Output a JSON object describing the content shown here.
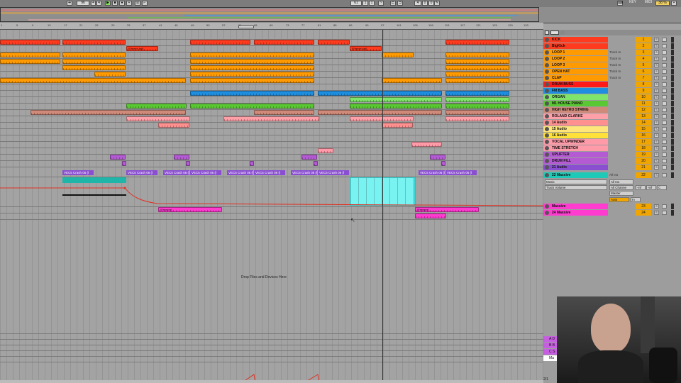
{
  "transport": {
    "tempo": "96",
    "time_sig_num": "4",
    "time_sig_den": "4",
    "bar_pos": "61",
    "beat_pos": "1",
    "sub_pos": "1",
    "loop_len": "4",
    "loop_beat": "0",
    "loop_sub": "0",
    "key_label": "KEY",
    "midi_label": "MIDI",
    "cpu": "38 %"
  },
  "ruler": {
    "ticks": [
      "1",
      "5",
      "9",
      "13",
      "17",
      "21",
      "25",
      "29",
      "33",
      "37",
      "41",
      "45",
      "49",
      "53",
      "57",
      "61",
      "65",
      "69",
      "73",
      "77",
      "81",
      "85",
      "89",
      "93",
      "97",
      "101",
      "105",
      "109",
      "113",
      "117",
      "121",
      "125",
      "129",
      "133"
    ]
  },
  "arrangement": {
    "drop_hint": "Drop Files and Devices Here",
    "freeze_tail_label": "(Freeze tail)",
    "freezer_label": "(Freezer)",
    "crash_label": "VEC5 Crash 06 (l"
  },
  "mixer": {
    "tracks": [
      {
        "num": "1",
        "name": "KICK",
        "color": "#ff3b1f",
        "io": ""
      },
      {
        "num": "2",
        "name": "BigKick",
        "color": "#ff3b1f",
        "io": ""
      },
      {
        "num": "3",
        "name": "LOOP 1",
        "color": "#ff9a00",
        "io": "Track In"
      },
      {
        "num": "4",
        "name": "LOOP 2",
        "color": "#ff9a00",
        "io": "Track In"
      },
      {
        "num": "5",
        "name": "LOOP 3",
        "color": "#ff9a00",
        "io": "Track In"
      },
      {
        "num": "6",
        "name": "OPEN HAT",
        "color": "#ff9a00",
        "io": "Track In"
      },
      {
        "num": "7",
        "name": "CLAP",
        "color": "#ff9a00",
        "io": "Track In"
      },
      {
        "num": "8",
        "name": "DRUM BUSS",
        "color": "#ff1a1a",
        "io": ""
      },
      {
        "num": "9",
        "name": "FM BASS",
        "color": "#1e8fe0",
        "io": ""
      },
      {
        "num": "10",
        "name": "ORGAN",
        "color": "#7fe46a",
        "io": ""
      },
      {
        "num": "11",
        "name": "M1 HOUSE PIANO",
        "color": "#5ac832",
        "io": ""
      },
      {
        "num": "12",
        "name": "HIGH RETRO STRING",
        "color": "#d08a7a",
        "io": ""
      },
      {
        "num": "13",
        "name": "ROLAND CLARKE",
        "color": "#ffa0a8",
        "io": ""
      },
      {
        "num": "14",
        "name": "14 Audio",
        "color": "#ff9090",
        "io": ""
      },
      {
        "num": "15",
        "name": "15 Audio",
        "color": "#ffe67a",
        "io": ""
      },
      {
        "num": "16",
        "name": "16 Audio",
        "color": "#ffe13a",
        "io": ""
      },
      {
        "num": "17",
        "name": "VOCAL UPWINDER",
        "color": "#ff9aa8",
        "io": ""
      },
      {
        "num": "18",
        "name": "TIME STRETCH",
        "color": "#ff9aa8",
        "io": ""
      },
      {
        "num": "19",
        "name": "UPLIFTER",
        "color": "#b45ad2",
        "io": ""
      },
      {
        "num": "20",
        "name": "DRUM FILL",
        "color": "#b45ad2",
        "io": ""
      },
      {
        "num": "21",
        "name": "21 Audio",
        "color": "#8a4fd0",
        "io": ""
      },
      {
        "num": "22",
        "name": "22 Massive",
        "color": "#1fc9b8",
        "io": "All Ins"
      },
      {
        "num": "23",
        "name": "Massive",
        "color": "#ff3bd0",
        "io": ""
      },
      {
        "num": "24",
        "name": "24 Massive",
        "color": "#ff3bd0",
        "io": ""
      }
    ],
    "massive_panel": {
      "midi_from": "Music",
      "channel": "All Channe",
      "device": "Track Volume",
      "output": "Master",
      "vol": "-inf",
      "pan": "C",
      "auto_label": "Auto",
      "in_label": "In"
    },
    "returns": [
      {
        "name": "A D",
        "color": "#c65ee0"
      },
      {
        "name": "B B",
        "color": "#c65ee0"
      },
      {
        "name": "C S",
        "color": "#c65ee0"
      },
      {
        "name": "Ma",
        "color": "#ffffff"
      }
    ],
    "page_indicator": "2/1"
  }
}
